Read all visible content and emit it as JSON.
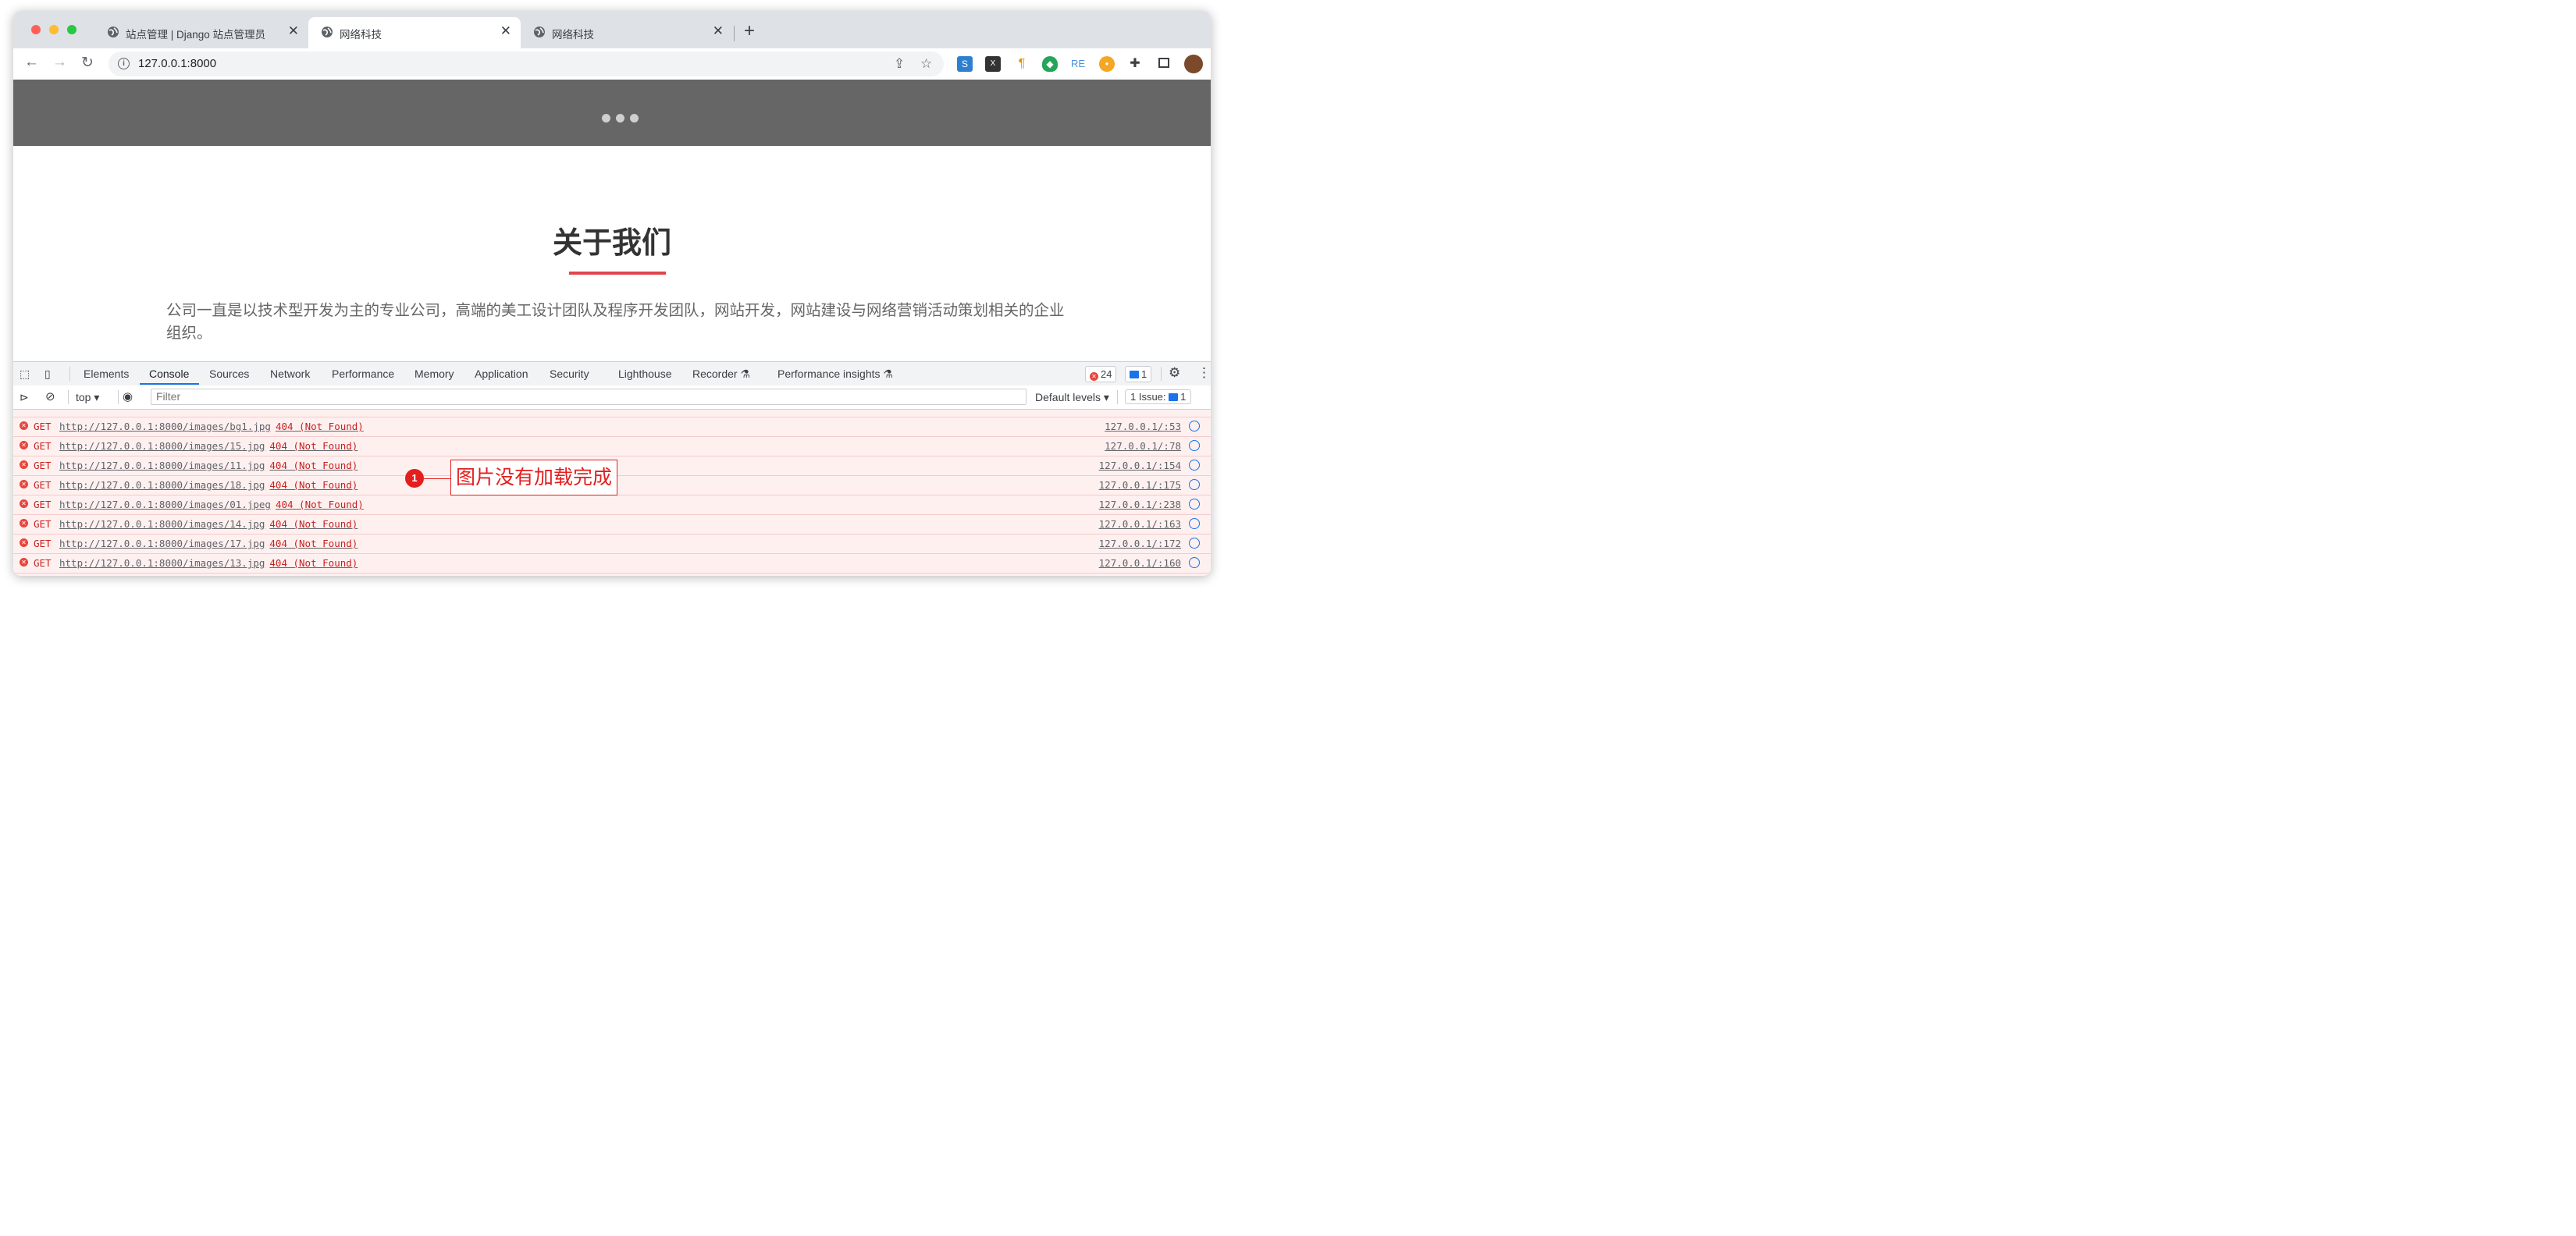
{
  "browser": {
    "tabs": [
      {
        "title": "站点管理 | Django 站点管理员",
        "active": false
      },
      {
        "title": "网络科技",
        "active": true
      },
      {
        "title": "网络科技",
        "active": false
      }
    ],
    "address": "127.0.0.1:8000"
  },
  "page": {
    "heading": "关于我们",
    "intro": "公司一直是以技术型开发为主的专业公司，高端的美工设计团队及程序开发团队，网站开发，网站建设与网络营销活动策划相关的企业组织。"
  },
  "devtools": {
    "tabs": [
      "Elements",
      "Console",
      "Sources",
      "Network",
      "Performance",
      "Memory",
      "Application",
      "Security",
      "Lighthouse",
      "Recorder",
      "Performance insights"
    ],
    "active_tab": "Console",
    "error_count": "24",
    "message_count": "1",
    "context": "top",
    "filter_placeholder": "Filter",
    "levels": "Default levels",
    "issues_label": "1 Issue:",
    "issues_count": "1",
    "log": [
      {
        "method": "GET",
        "url": "http://127.0.0.1:8000/images/bg1.jpg",
        "status": "404 (Not Found)",
        "source": "127.0.0.1/:53"
      },
      {
        "method": "GET",
        "url": "http://127.0.0.1:8000/images/15.jpg",
        "status": "404 (Not Found)",
        "source": "127.0.0.1/:78"
      },
      {
        "method": "GET",
        "url": "http://127.0.0.1:8000/images/11.jpg",
        "status": "404 (Not Found)",
        "source": "127.0.0.1/:154"
      },
      {
        "method": "GET",
        "url": "http://127.0.0.1:8000/images/18.jpg",
        "status": "404 (Not Found)",
        "source": "127.0.0.1/:175"
      },
      {
        "method": "GET",
        "url": "http://127.0.0.1:8000/images/01.jpeg",
        "status": "404 (Not Found)",
        "source": "127.0.0.1/:238"
      },
      {
        "method": "GET",
        "url": "http://127.0.0.1:8000/images/14.jpg",
        "status": "404 (Not Found)",
        "source": "127.0.0.1/:163"
      },
      {
        "method": "GET",
        "url": "http://127.0.0.1:8000/images/17.jpg",
        "status": "404 (Not Found)",
        "source": "127.0.0.1/:172"
      },
      {
        "method": "GET",
        "url": "http://127.0.0.1:8000/images/13.jpg",
        "status": "404 (Not Found)",
        "source": "127.0.0.1/:160"
      }
    ]
  },
  "annotation": {
    "number": "1",
    "text": "图片没有加载完成"
  },
  "colors": {
    "accent_red": "#e0454c",
    "error_red": "#c5221f",
    "devtools_blue": "#1a73e8"
  }
}
